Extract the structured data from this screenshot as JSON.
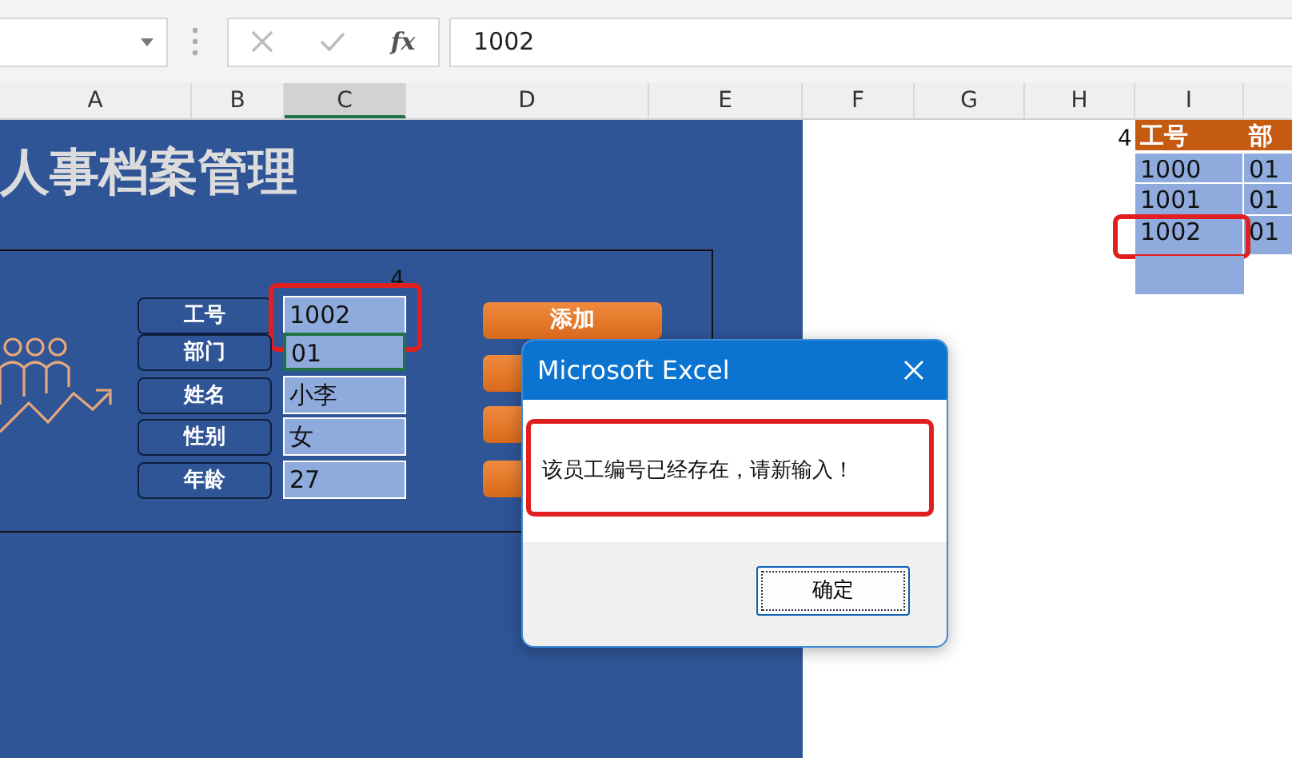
{
  "formula_bar": {
    "function_label": "fx",
    "value": "1002"
  },
  "columns": [
    {
      "label": "A",
      "selected": false
    },
    {
      "label": "B",
      "selected": false
    },
    {
      "label": "C",
      "selected": true
    },
    {
      "label": "D",
      "selected": false
    },
    {
      "label": "E",
      "selected": false
    },
    {
      "label": "F",
      "selected": false
    },
    {
      "label": "G",
      "selected": false
    },
    {
      "label": "H",
      "selected": false
    },
    {
      "label": "I",
      "selected": false
    }
  ],
  "panel": {
    "title": "人事档案管理",
    "counter": "4",
    "fields": [
      {
        "label": "工号",
        "value": "1002",
        "selected": false,
        "highlighted": true
      },
      {
        "label": "部门",
        "value": "01",
        "selected": true,
        "highlighted": false
      },
      {
        "label": "姓名",
        "value": "小李",
        "selected": false,
        "highlighted": false
      },
      {
        "label": "性别",
        "value": "女",
        "selected": false,
        "highlighted": false
      },
      {
        "label": "年龄",
        "value": "27",
        "selected": false,
        "highlighted": false
      }
    ],
    "buttons": [
      {
        "label": "添加",
        "covered": false
      },
      {
        "covered": true
      },
      {
        "covered": true
      },
      {
        "covered": true
      }
    ]
  },
  "sheet_table": {
    "counter": "4",
    "columns": [
      "工号",
      "部"
    ],
    "rows": [
      {
        "cells": [
          "1000",
          "01"
        ],
        "highlighted": false
      },
      {
        "cells": [
          "1001",
          "01"
        ],
        "highlighted": false
      },
      {
        "cells": [
          "1002",
          "01"
        ],
        "highlighted": true
      }
    ]
  },
  "dialog": {
    "title": "Microsoft Excel",
    "message": "该员工编号已经存在，请新输入！",
    "message_highlighted": true,
    "ok_button": "确定"
  }
}
